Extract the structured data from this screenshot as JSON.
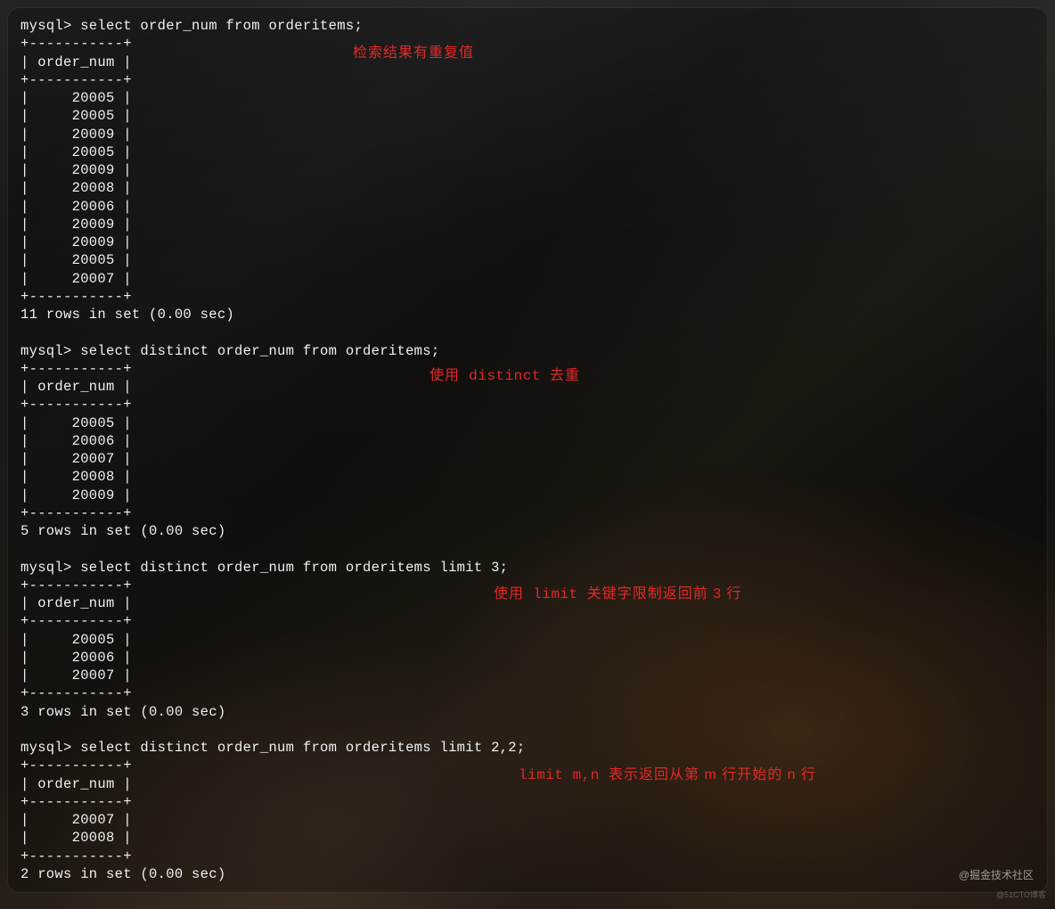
{
  "annotations": {
    "a1": "检索结果有重复值",
    "a2_pre": "使用",
    "a2_kw": " distinct ",
    "a2_post": "去重",
    "a3_pre": "使用",
    "a3_kw": " limit ",
    "a3_post": "关键字限制返回前 3 行",
    "a4_pre": "",
    "a4_kw": "limit m,n ",
    "a4_post": "表示返回从第 m 行开始的 n 行"
  },
  "terminal_lines": [
    "mysql> select order_num from orderitems;",
    "+-----------+",
    "| order_num |",
    "+-----------+",
    "|     20005 |",
    "|     20005 |",
    "|     20009 |",
    "|     20005 |",
    "|     20009 |",
    "|     20008 |",
    "|     20006 |",
    "|     20009 |",
    "|     20009 |",
    "|     20005 |",
    "|     20007 |",
    "+-----------+",
    "11 rows in set (0.00 sec)",
    "",
    "mysql> select distinct order_num from orderitems;",
    "+-----------+",
    "| order_num |",
    "+-----------+",
    "|     20005 |",
    "|     20006 |",
    "|     20007 |",
    "|     20008 |",
    "|     20009 |",
    "+-----------+",
    "5 rows in set (0.00 sec)",
    "",
    "mysql> select distinct order_num from orderitems limit 3;",
    "+-----------+",
    "| order_num |",
    "+-----------+",
    "|     20005 |",
    "|     20006 |",
    "|     20007 |",
    "+-----------+",
    "3 rows in set (0.00 sec)",
    "",
    "mysql> select distinct order_num from orderitems limit 2,2;",
    "+-----------+",
    "| order_num |",
    "+-----------+",
    "|     20007 |",
    "|     20008 |",
    "+-----------+",
    "2 rows in set (0.00 sec)"
  ],
  "watermark1": "@掘金技术社区",
  "watermark2": "@51CTO博客"
}
